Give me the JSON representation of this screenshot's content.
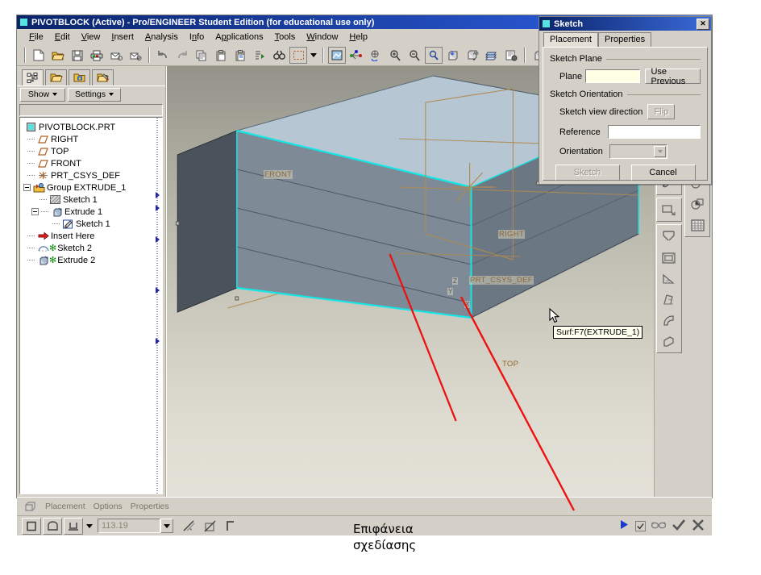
{
  "window": {
    "title": "PIVOTBLOCK (Active) - Pro/ENGINEER Student Edition (for educational use only)",
    "icon": "part-icon"
  },
  "menu": {
    "items": [
      {
        "label": "File",
        "accel": "F"
      },
      {
        "label": "Edit",
        "accel": "E"
      },
      {
        "label": "View",
        "accel": "V"
      },
      {
        "label": "Insert",
        "accel": "I"
      },
      {
        "label": "Analysis",
        "accel": "A"
      },
      {
        "label": "Info",
        "accel": "n"
      },
      {
        "label": "Applications",
        "accel": "p"
      },
      {
        "label": "Tools",
        "accel": "T"
      },
      {
        "label": "Window",
        "accel": "W"
      },
      {
        "label": "Help",
        "accel": "H"
      }
    ]
  },
  "toolbar": {
    "file_group": [
      "new-icon",
      "open-icon",
      "save-icon",
      "print-icon",
      "send-mail-icon",
      "send-link-icon"
    ],
    "edit_group": [
      "undo-icon",
      "redo-icon",
      "copy-icon",
      "paste-icon",
      "paste-special-icon",
      "regenerate-icon",
      "find-icon",
      "selection-filter-icon"
    ],
    "view_group": [
      "repaint-icon",
      "datum-display-icon",
      "spin-center-icon",
      "zoom-in-icon",
      "zoom-out-icon",
      "refit-icon",
      "reorient-icon",
      "saved-views-icon",
      "layers-icon",
      "model-player-icon"
    ],
    "extra_group": [
      "shade-icon"
    ]
  },
  "tree_panel": {
    "tabs": [
      "model-tree-icon",
      "folder-browser-icon",
      "favorites-icon",
      "working-directory-icon"
    ],
    "show_button": "Show",
    "settings_button": "Settings",
    "nodes": [
      {
        "label": "PIVOTBLOCK.PRT",
        "icon": "part-icon",
        "depth": 0,
        "expander": false,
        "star": false
      },
      {
        "label": "RIGHT",
        "icon": "datum-plane-icon",
        "depth": 1,
        "expander": false,
        "star": false
      },
      {
        "label": "TOP",
        "icon": "datum-plane-icon",
        "depth": 1,
        "expander": false,
        "star": false
      },
      {
        "label": "FRONT",
        "icon": "datum-plane-icon",
        "depth": 1,
        "expander": false,
        "star": false
      },
      {
        "label": "PRT_CSYS_DEF",
        "icon": "coord-system-icon",
        "depth": 1,
        "expander": false,
        "star": false
      },
      {
        "label": "Group EXTRUDE_1",
        "icon": "group-icon",
        "depth": 1,
        "expander": true,
        "star": false
      },
      {
        "label": "Sketch 1",
        "icon": "sketch-hatched-icon",
        "depth": 2,
        "expander": false,
        "star": false
      },
      {
        "label": "Extrude 1",
        "icon": "extrude-icon",
        "depth": 2,
        "expander": true,
        "star": false
      },
      {
        "label": "Sketch 1",
        "icon": "sketch-icon",
        "depth": 3,
        "expander": false,
        "star": false
      },
      {
        "label": "Insert Here",
        "icon": "insert-here-icon",
        "depth": 1,
        "expander": false,
        "star": false
      },
      {
        "label": "Sketch 2",
        "icon": "sketch-curve-icon",
        "depth": 1,
        "expander": false,
        "star": true
      },
      {
        "label": "Extrude 2",
        "icon": "extrude-icon",
        "depth": 1,
        "expander": false,
        "star": true
      }
    ]
  },
  "graphics": {
    "datum_labels": [
      "FRONT",
      "RIGHT",
      "TOP",
      "PRT_CSYS_DEF"
    ],
    "axis_labels": [
      "Z",
      "Y",
      "X"
    ],
    "tooltip": "Surf:F7(EXTRUDE_1)",
    "cursor": "arrow-cursor",
    "colors": {
      "face_top": "#b6c6d2",
      "face_front": "#7e8b96",
      "face_side": "#4a535c",
      "highlight_edge": "#14e6e6",
      "datum_color": "#b08a50",
      "callout_line": "#ee1111"
    }
  },
  "right_toolbar": {
    "group1": [
      "datum-point-icon",
      "datum-axis-icon"
    ],
    "group2": [
      "sketch-tool-icon"
    ],
    "group3": [
      "extrude-tool-icon",
      "shell-tool-icon",
      "rib-tool-icon",
      "draft-tool-icon",
      "round-tool-icon",
      "chamfer-tool-icon"
    ],
    "group4": [
      "mirror-icon",
      "pattern-icon",
      "copy-paste-icon",
      "table-icon"
    ]
  },
  "dashboard": {
    "tabs": [
      "Placement",
      "Options",
      "Properties"
    ],
    "feature_icon": "extrude-feature-icon",
    "shape_buttons": [
      "solid-icon",
      "surface-icon",
      "depth-blind-icon"
    ],
    "depth_value": "113.19",
    "option_buttons": [
      "thicken-icon",
      "remove-material-icon",
      "flip-side-icon"
    ],
    "right_controls": [
      "resume-icon",
      "preview-checkbox",
      "glasses-icon",
      "accept-icon",
      "cancel-icon"
    ],
    "preview_checked": true
  },
  "sketch_dialog": {
    "title": "Sketch",
    "close_label": "✕",
    "tabs": [
      {
        "label": "Placement",
        "active": true
      },
      {
        "label": "Properties",
        "active": false
      }
    ],
    "sketch_plane_group": "Sketch Plane",
    "plane_label": "Plane",
    "plane_value": "",
    "use_previous_button": "Use Previous",
    "sketch_orientation_group": "Sketch Orientation",
    "view_direction_label": "Sketch view direction",
    "flip_button": "Flip",
    "reference_label": "Reference",
    "reference_value": "",
    "orientation_label": "Orientation",
    "orientation_value": "",
    "ok_button": "Sketch",
    "cancel_button": "Cancel"
  },
  "callout": {
    "line1": "Επιφάνεια",
    "line2": "σχεδίασης"
  }
}
